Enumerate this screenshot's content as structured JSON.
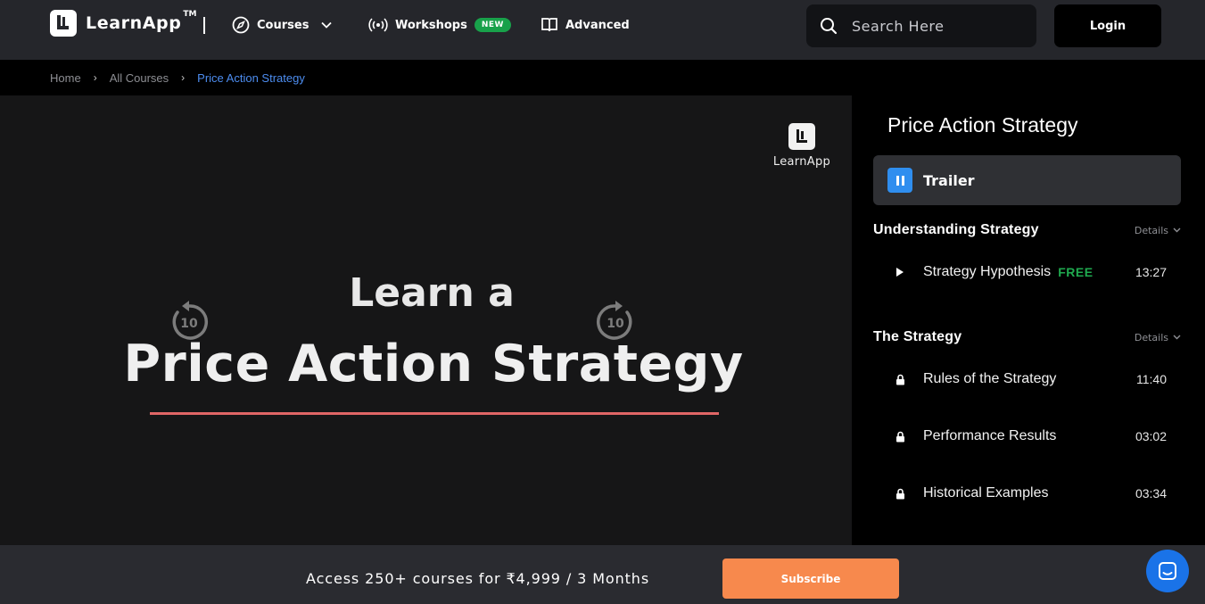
{
  "brand": {
    "name": "LearnApp",
    "tm": "TM"
  },
  "nav": {
    "courses": "Courses",
    "workshops": "Workshops",
    "workshops_badge": "NEW",
    "advanced": "Advanced"
  },
  "search": {
    "placeholder": "Search Here"
  },
  "login": "Login",
  "breadcrumb": {
    "home": "Home",
    "all_courses": "All Courses",
    "current": "Price Action Strategy"
  },
  "video": {
    "watermark": "LearnApp",
    "line1": "Learn a",
    "line2": "Price Action Strategy",
    "rewind_seconds": "10",
    "forward_seconds": "10"
  },
  "sidebar": {
    "title": "Price Action Strategy",
    "trailer": "Trailer",
    "details_label": "Details",
    "sections": [
      {
        "title": "Understanding Strategy",
        "lessons": [
          {
            "name": "Strategy Hypothesis",
            "tag": "FREE",
            "duration": "13:27",
            "icon": "play-icon"
          }
        ]
      },
      {
        "title": "The Strategy",
        "lessons": [
          {
            "name": "Rules of the Strategy",
            "duration": "11:40",
            "icon": "lock-icon"
          },
          {
            "name": "Performance Results",
            "duration": "03:02",
            "icon": "lock-icon"
          },
          {
            "name": "Historical Examples",
            "duration": "03:34",
            "icon": "lock-icon"
          }
        ]
      }
    ]
  },
  "bottom": {
    "offer": "Access 250+ courses for ₹4,999 / 3 Months",
    "subscribe": "Subscribe"
  },
  "colors": {
    "accent_blue": "#2f8eef",
    "free_green": "#1faa4f",
    "subscribe_orange": "#f7894d",
    "breadcrumb_active": "#4d8df0"
  }
}
